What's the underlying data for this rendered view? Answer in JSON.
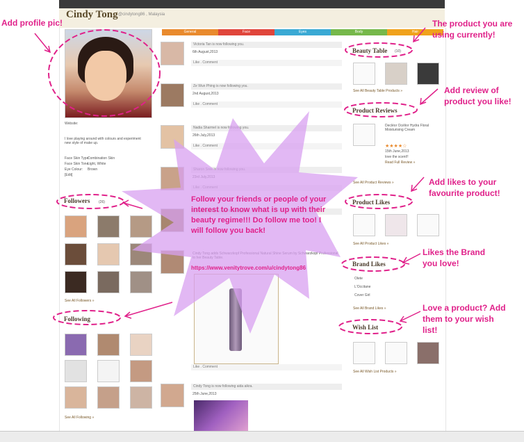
{
  "profile": {
    "name": "Cindy Tong",
    "subtitle": "@cindytong86 , Malaysia",
    "website_label": "Website:",
    "about": "I love playing around with colours and experiment new style of make up.",
    "skin_type_label": "Face Skin Type:",
    "skin_type": "Combination Skin",
    "skin_tone_label": "Face Skin Tone:",
    "skin_tone": "Light, White",
    "eye_colour_label": "Eye Colour:",
    "eye_colour": "Brown",
    "edit": "[Edit]"
  },
  "tabs": [
    "General",
    "Face",
    "Eyes",
    "Body",
    "Hair"
  ],
  "sections": {
    "followers": "Followers",
    "followers_count": "(26)",
    "see_all_followers": "See All Followers »",
    "following": "Following",
    "see_all_following": "See All Following »",
    "beauty_table": "Beauty Table",
    "beauty_count": "(10)",
    "see_all_beauty": "See All Beauty Table Products »",
    "product_reviews": "Product Reviews",
    "review_product": "Decléor Océlior Hydra Floral Moisturising Cream",
    "review_date": "15th June,2013",
    "review_text": "love the scent!!",
    "read_review": "Read Full Review »",
    "see_all_reviews": "See All Product Reviews »",
    "product_likes": "Product Likes",
    "see_all_likes": "See All Product Likes »",
    "brand_likes": "Brand Likes",
    "brands": [
      "Olete",
      "L'Occitane",
      "Cover Girl"
    ],
    "see_all_brands": "See All Brand Likes »",
    "wish_list": "Wish List",
    "see_all_wish": "See All Wish List Products »"
  },
  "feed": [
    {
      "text": "Victoria Tan is now following you.",
      "date": "6th August,2013"
    },
    {
      "text": "Ze Wun Phing is now following you.",
      "date": "2nd August,2013"
    },
    {
      "text": "Nadia Sharmel is now following you.",
      "date": "26th July,2013"
    },
    {
      "text": "Sharon Sree is now following you.",
      "date": "23rd July,2013"
    },
    {
      "text": "Follow Yolanda is now following you.",
      "date": ""
    },
    {
      "text": "Cindy Tong adds Schwarzkopf Professional Natural Shine Serum by Schwarzkopf Professional to her Beauty Table.",
      "date": ""
    },
    {
      "text": "Cindy Tong is now following aida aikra.",
      "date": "25th June,2013"
    }
  ],
  "feed_actions": "Like . Comment",
  "annotations": {
    "profile_pic": "Add profile pic!",
    "product_using": "The product you are using currently!",
    "review": "Add review of product you like!",
    "likes": "Add likes to your favourite product!",
    "brand": "Likes the Brand you love!",
    "wish": "Love a product? Add them to your wish list!",
    "follow_friends": "Follow your friends or people of your interest to know what is up with their beauty regime!!! Do follow me too! I will follow you back!",
    "url": "https://www.venitytrove.com/u/cindytong86"
  },
  "colors": {
    "accent": "#e0218a",
    "starburst": "#d8a0f0"
  }
}
